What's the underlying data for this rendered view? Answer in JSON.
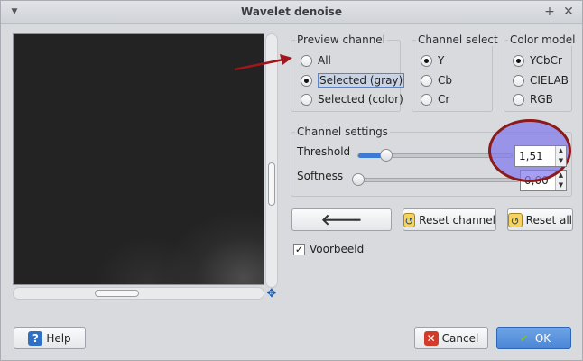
{
  "window": {
    "title": "Wavelet denoise",
    "menu_icon": "chevron-down-icon",
    "pin_icon": "plus-icon",
    "close_icon": "close-icon"
  },
  "preview_channel": {
    "title": "Preview channel",
    "options": [
      {
        "label": "All",
        "checked": false
      },
      {
        "label": "Selected (gray)",
        "checked": true
      },
      {
        "label": "Selected (color)",
        "checked": false
      }
    ]
  },
  "channel_select": {
    "title": "Channel select",
    "options": [
      {
        "label": "Y",
        "checked": true
      },
      {
        "label": "Cb",
        "checked": false
      },
      {
        "label": "Cr",
        "checked": false
      }
    ]
  },
  "color_model": {
    "title": "Color model",
    "options": [
      {
        "label": "YCbCr",
        "checked": true
      },
      {
        "label": "CIELAB",
        "checked": false
      },
      {
        "label": "RGB",
        "checked": false
      }
    ]
  },
  "channel_settings": {
    "title": "Channel settings",
    "threshold": {
      "label": "Threshold",
      "value": "1,51",
      "fraction": 0.18
    },
    "softness": {
      "label": "Softness",
      "value": "0,00",
      "fraction": 0.0
    }
  },
  "buttons": {
    "back_icon": "arrow-left-icon",
    "reset_channel": "Reset channel",
    "reset_all": "Reset all",
    "help": "Help",
    "cancel": "Cancel",
    "ok": "OK"
  },
  "preview_toggle": {
    "label": "Voorbeeld",
    "checked": true
  },
  "colors": {
    "annotation_red": "#8b1a1a",
    "highlight_purple": "#8278eb",
    "accent_blue": "#3c7bd1"
  }
}
